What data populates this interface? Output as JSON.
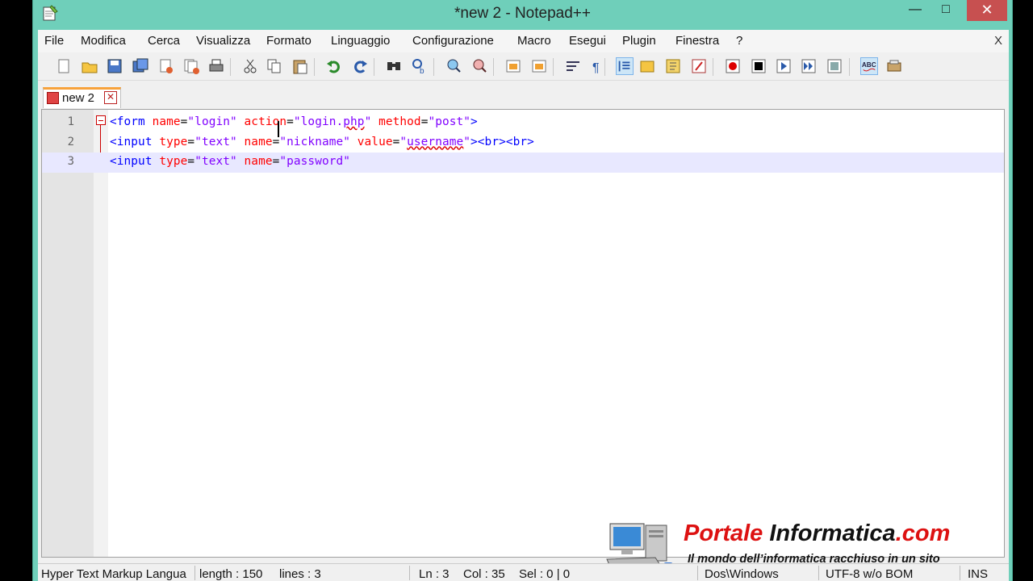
{
  "window": {
    "title": "*new  2 - Notepad++",
    "minimize": "—",
    "maximize": "□",
    "close": "✕"
  },
  "menu": {
    "items": [
      "File",
      "Modifica",
      "Cerca",
      "Visualizza",
      "Formato",
      "Linguaggio",
      "Configurazione",
      "Macro",
      "Esegui",
      "Plugin",
      "Finestra",
      "?"
    ],
    "close": "X"
  },
  "toolbar": {
    "icons": [
      "new-file-icon",
      "open-file-icon",
      "save-icon",
      "save-all-icon",
      "close-icon",
      "close-all-icon",
      "print-icon",
      "cut-icon",
      "copy-icon",
      "paste-icon",
      "undo-icon",
      "redo-icon",
      "find-icon",
      "replace-icon",
      "zoom-in-icon",
      "zoom-out-icon",
      "sync-vertical-icon",
      "sync-horizontal-icon",
      "word-wrap-icon",
      "show-all-chars-icon",
      "indent-guide-icon",
      "doc-map-icon",
      "function-list-icon",
      "folder-workspace-icon",
      "record-macro-icon",
      "stop-record-icon",
      "play-macro-icon",
      "run-macro-multiple-icon",
      "save-macro-icon",
      "spell-check-icon",
      "plugin-icon"
    ]
  },
  "tab": {
    "label": "new  2",
    "close": "✕"
  },
  "editor": {
    "lines": [
      {
        "num": "1",
        "tokens": [
          [
            "tag",
            "<form "
          ],
          [
            "attr",
            "name"
          ],
          [
            "op",
            "="
          ],
          [
            "val",
            "\"login\""
          ],
          [
            "op",
            " "
          ],
          [
            "attr",
            "action"
          ],
          [
            "op",
            "="
          ],
          [
            "val",
            "\"login."
          ],
          [
            "val_err",
            "php"
          ],
          [
            "val",
            "\""
          ],
          [
            "op",
            " "
          ],
          [
            "attr",
            "method"
          ],
          [
            "op",
            "="
          ],
          [
            "val",
            "\"post\""
          ],
          [
            "tag",
            ">"
          ]
        ]
      },
      {
        "num": "2",
        "tokens": [
          [
            "tag",
            "<input "
          ],
          [
            "attr",
            "type"
          ],
          [
            "op",
            "="
          ],
          [
            "val",
            "\"text\""
          ],
          [
            "op",
            " "
          ],
          [
            "attr",
            "name"
          ],
          [
            "op",
            "="
          ],
          [
            "val",
            "\"nickname\""
          ],
          [
            "op",
            " "
          ],
          [
            "attr",
            "value"
          ],
          [
            "op",
            "="
          ],
          [
            "val",
            "\""
          ],
          [
            "val_err",
            "username"
          ],
          [
            "val",
            "\""
          ],
          [
            "tag",
            "><br><br>"
          ]
        ]
      },
      {
        "num": "3",
        "tokens": [
          [
            "tag",
            "<input "
          ],
          [
            "attr",
            "type"
          ],
          [
            "op",
            "="
          ],
          [
            "val",
            "\"text\""
          ],
          [
            "op",
            " "
          ],
          [
            "attr",
            "name"
          ],
          [
            "op",
            "="
          ],
          [
            "val",
            "\"password\""
          ]
        ]
      }
    ]
  },
  "watermark": {
    "brand_red1": "Portale ",
    "brand_black": "Informatica",
    "brand_red2": ".com",
    "tagline": "Il mondo dell’informatica racchiuso in un sito"
  },
  "status": {
    "language": "Hyper Text Markup Langua",
    "length": "length : 150",
    "lines": "lines : 3",
    "ln": "Ln : 3",
    "col": "Col : 35",
    "sel": "Sel : 0 | 0",
    "eol": "Dos\\Windows",
    "encoding": "UTF-8 w/o BOM",
    "mode": "INS"
  },
  "colors": {
    "tag": "#0000ff",
    "attr": "#ff0000",
    "value": "#8000ff",
    "tab_accent": "#f7a23b",
    "title_bar": "#6fcfba"
  }
}
